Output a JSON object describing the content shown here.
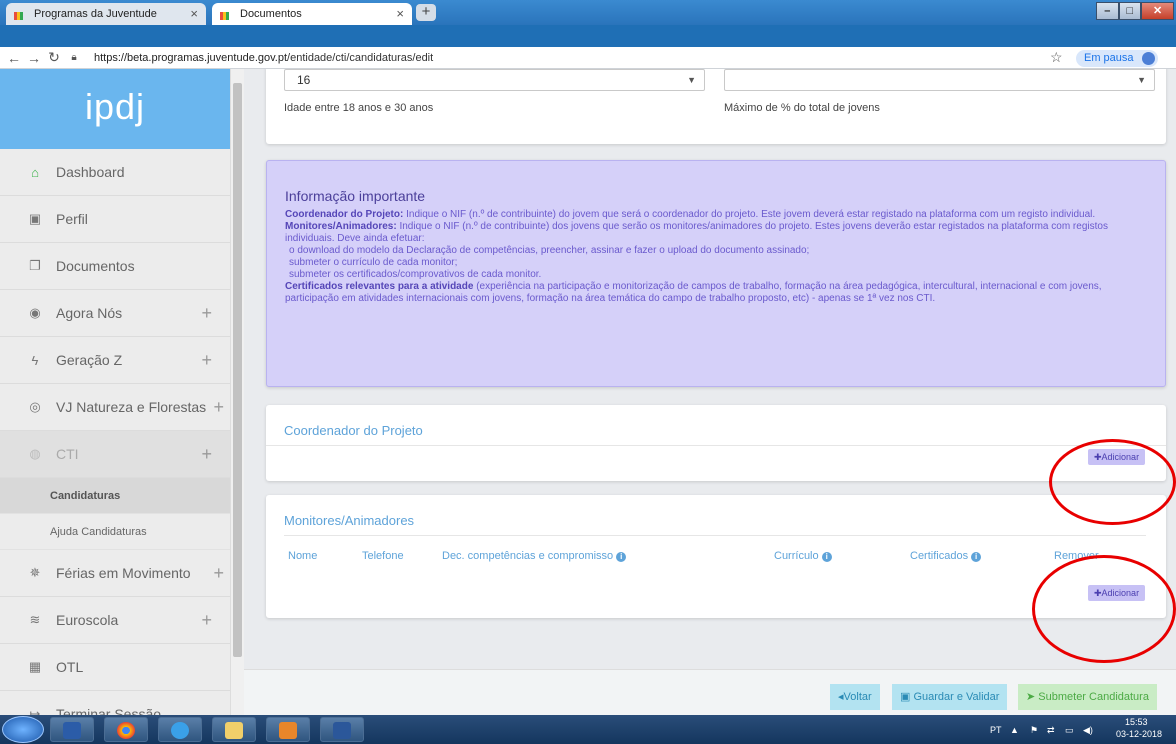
{
  "browser": {
    "tabs": [
      {
        "label": "Programas da Juventude"
      },
      {
        "label": "Documentos"
      }
    ],
    "url_domain": "https://beta.programas.juventude.gov.pt",
    "url_path": "/entidade/cti/candidaturas/edit",
    "profile_label": "Em pausa"
  },
  "sidebar": {
    "logo": "ipdj",
    "items": [
      {
        "label": "Dashboard",
        "icon": "home-icon",
        "glyph": "⌂"
      },
      {
        "label": "Perfil",
        "icon": "id-card-icon",
        "glyph": "▣"
      },
      {
        "label": "Documentos",
        "icon": "documents-icon",
        "glyph": "❐"
      },
      {
        "label": "Agora Nós",
        "icon": "agora-nos-icon",
        "glyph": "◉"
      },
      {
        "label": "Geração Z",
        "icon": "geracao-z-icon",
        "glyph": "ϟ"
      },
      {
        "label": "VJ Natureza e Florestas",
        "icon": "natureza-icon",
        "glyph": "◎"
      },
      {
        "label": "CTI",
        "icon": "cti-icon",
        "glyph": "◍"
      },
      {
        "label": "Férias em Movimento",
        "icon": "ferias-icon",
        "glyph": "✵"
      },
      {
        "label": "Euroscola",
        "icon": "euroscola-icon",
        "glyph": "≋"
      },
      {
        "label": "OTL",
        "icon": "otl-icon",
        "glyph": "▦"
      },
      {
        "label": "Terminar Sessão",
        "icon": "logout-icon",
        "glyph": "↦"
      }
    ],
    "subitems": [
      {
        "label": "Candidaturas"
      },
      {
        "label": "Ajuda Candidaturas"
      }
    ]
  },
  "form": {
    "age_select_value": "16",
    "age_hint": "Idade entre 18 anos e 30 anos",
    "percent_select_value": "",
    "percent_hint": "Máximo de % do total de jovens"
  },
  "info": {
    "title": "Informação importante",
    "coord_label": "Coordenador do Projeto:",
    "coord_text": " Indique o NIF (n.º de contribuinte) do jovem que será o coordenador do projeto. Este jovem deverá estar registado na plataforma com um registo individual.",
    "mon_label": "Monitores/Animadores:",
    "mon_text": " Indique o NIF (n.º de contribuinte) dos jovens que serão os monitores/animadores do projeto. Estes jovens deverão estar registados na plataforma com registos individuais. Deve ainda efetuar:",
    "mon_steps": [
      "o download do modelo da Declaração de competências, preencher, assinar e fazer o upload do documento assinado;",
      "submeter o currículo de cada monitor;",
      "submeter os certificados/comprovativos de cada monitor."
    ],
    "cert_label": "Certificados relevantes para a atividade",
    "cert_text": " (experiência na participação e monitorização de campos de trabalho, formação na área pedagógica, intercultural, internacional e com jovens, participação em atividades internacionais com jovens, formação na área temática do campo de trabalho proposto, etc) - apenas se 1ª vez nos CTI."
  },
  "coordinator": {
    "title": "Coordenador do Projeto",
    "add_label": "✚Adicionar"
  },
  "monitors": {
    "title": "Monitores/Animadores",
    "columns": [
      "Nome",
      "Telefone",
      "Dec. competências e compromisso",
      "Currículo",
      "Certificados",
      "Remover"
    ],
    "add_label": "✚Adicionar"
  },
  "footer": {
    "back": "◂Voltar",
    "save": "Guardar e Validar",
    "submit": "Submeter Candidatura"
  },
  "taskbar": {
    "lang": "PT",
    "time": "15:53",
    "date": "03-12-2018"
  },
  "colors": {
    "accent": "#6ab6ee",
    "info_bg": "#d5d0f9",
    "highlight_circle": "#e80000"
  }
}
